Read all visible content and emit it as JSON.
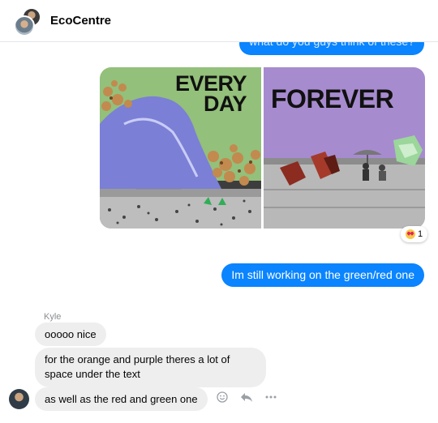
{
  "header": {
    "title": "EcoCentre"
  },
  "messages": {
    "outgoing_1": "what do you guys think of these?",
    "image": {
      "left_title_line1": "EVERY",
      "left_title_line2": "DAY",
      "right_title": "FOREVER"
    },
    "reaction_count": "1",
    "outgoing_2": "Im still working on the green/red one",
    "sender_name": "Kyle",
    "incoming_1": "ooooo nice",
    "incoming_2": "for the orange and purple theres a lot of space under the text",
    "incoming_3": "as well as the red and green one"
  },
  "icons": {
    "reaction": "heart-eyes-emoji",
    "emoji_action": "smiley-icon",
    "reply_action": "reply-icon",
    "more_action": "more-icon"
  },
  "colors": {
    "outgoing_bubble": "#0a84ff",
    "incoming_bubble": "#eeeeef"
  }
}
